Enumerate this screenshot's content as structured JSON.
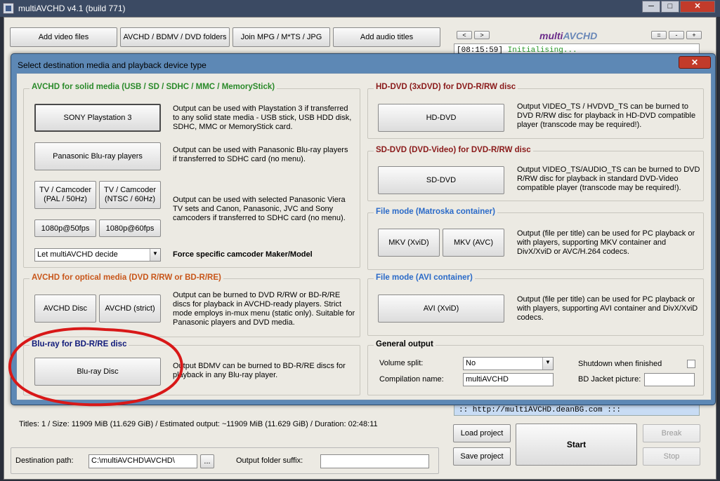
{
  "window": {
    "title": "multiAVCHD v4.1 (build 771)",
    "min_label": "─",
    "max_label": "□",
    "close_label": "✕"
  },
  "toolbar": {
    "add_video": "Add video files",
    "avchd_folders": "AVCHD / BDMV / DVD folders",
    "join": "Join MPG / M*TS / JPG",
    "add_audio": "Add audio titles"
  },
  "log": {
    "nav_prev": "<",
    "nav_next": ">",
    "logo_part1": "multi",
    "logo_part2": "AVCHD",
    "ctrl_a": "=",
    "ctrl_b": "-",
    "ctrl_c": "+",
    "time": "[08:15:59]",
    "message": "Initialising..."
  },
  "dialog": {
    "title": "Select destination media and playback device type",
    "close_label": "✕",
    "solid": {
      "title": "AVCHD for solid media (USB / SD / SDHC / MMC / MemoryStick)",
      "ps3_label": "SONY Playstation 3",
      "ps3_desc": "Output can be used with Playstation 3 if transferred to any solid state media - USB stick, USB HDD disk, SDHC, MMC or MemoryStick card.",
      "panasonic_label": "Panasonic Blu-ray players",
      "panasonic_desc": "Output can be used with Panasonic Blu-ray players if transferred to SDHC card (no menu).",
      "tv_pal_label": "TV / Camcoder\n(PAL / 50Hz)",
      "tv_ntsc_label": "TV / Camcoder\n(NTSC / 60Hz)",
      "tv_desc": "Output can be used with selected Panasonic Viera TV sets and Canon, Panasonic, JVC and Sony camcoders if transferred to SDHC card (no menu).",
      "p50_label": "1080p@50fps",
      "p60_label": "1080p@60fps",
      "maker_value": "Let multiAVCHD decide",
      "maker_label": "Force specific camcoder Maker/Model"
    },
    "optical": {
      "title": "AVCHD for optical media (DVD R/RW or BD-R/RE)",
      "disc_label": "AVCHD Disc",
      "strict_label": "AVCHD (strict)",
      "desc": "Output can be burned to DVD R/RW or BD-R/RE discs for playback in AVCHD-ready players. Strict mode employs in-mux menu (static only). Suitable for Panasonic players and DVD media."
    },
    "bluray": {
      "title": "Blu-ray for BD-R/RE disc",
      "label": "Blu-ray Disc",
      "desc": "Output BDMV can be burned to BD-R/RE discs for playback in any Blu-ray player."
    },
    "hddvd": {
      "title": "HD-DVD (3xDVD) for DVD-R/RW disc",
      "label": "HD-DVD",
      "desc": "Output VIDEO_TS / HVDVD_TS can be burned to DVD R/RW disc for playback in HD-DVD compatible player (transcode may be required!)."
    },
    "sddvd": {
      "title": "SD-DVD (DVD-Video) for DVD-R/RW disc",
      "label": "SD-DVD",
      "desc": "Output VIDEO_TS/AUDIO_TS can be burned to DVD R/RW disc for playback in standard DVD-Video compatible player (transcode may be required!)."
    },
    "mkv": {
      "title": "File mode (Matroska container)",
      "xvid_label": "MKV (XviD)",
      "avc_label": "MKV (AVC)",
      "desc": "Output (file per title) can be used for PC playback or with players, supporting MKV container and DivX/XviD or AVC/H.264 codecs."
    },
    "avi": {
      "title": "File mode (AVI container)",
      "label": "AVI (XviD)",
      "desc": "Output (file per title) can be used for PC playback or with players, supporting AVI container and DivX/XviD codecs."
    },
    "general": {
      "title": "General output",
      "volume_label": "Volume split:",
      "volume_value": "No",
      "compilation_label": "Compilation name:",
      "compilation_value": "multiAVCHD",
      "shutdown_label": "Shutdown when finished",
      "jacket_label": "BD Jacket picture:",
      "jacket_value": ""
    }
  },
  "url": ":: http://multiAVCHD.deanBG.com :::",
  "stats": "Titles: 1 / Size: 11909 MiB (11.629 GiB) / Estimated output: ~11909 MiB (11.629 GiB) / Duration: 02:48:11",
  "destination": {
    "label": "Destination path:",
    "value": "C:\\multiAVCHD\\AVCHD\\",
    "browse_label": "...",
    "suffix_label": "Output folder suffix:",
    "suffix_value": ""
  },
  "actions": {
    "load": "Load project",
    "save": "Save project",
    "start": "Start",
    "break": "Break",
    "stop": "Stop"
  },
  "colors": {
    "group_green": "#2a8a2a",
    "group_orange": "#c8561a",
    "group_navy": "#101a7a",
    "group_maroon": "#8a1a1a",
    "group_blue": "#2a6ac8",
    "annotation_red": "#d81818",
    "log_green": "#2a9a2a"
  }
}
